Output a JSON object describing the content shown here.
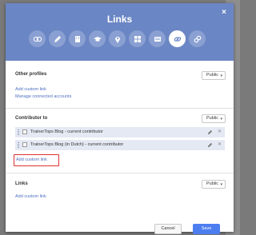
{
  "dialog": {
    "title": "Links",
    "close_symbol": "×"
  },
  "categories": [
    {
      "icon": "circles-icon",
      "active": false
    },
    {
      "icon": "pencil-icon",
      "active": false
    },
    {
      "icon": "building-icon",
      "active": false
    },
    {
      "icon": "graduation-cap-icon",
      "active": false
    },
    {
      "icon": "map-pin-icon",
      "active": false
    },
    {
      "icon": "grid-icon",
      "active": false
    },
    {
      "icon": "card-icon",
      "active": false
    },
    {
      "icon": "link-icon",
      "active": true
    },
    {
      "icon": "chain-icon",
      "active": false
    }
  ],
  "other_profiles": {
    "label": "Other profiles",
    "visibility": "Public",
    "add_link": "Add custom link",
    "manage_link": "Manage connected accounts"
  },
  "contributor": {
    "label": "Contributor to",
    "visibility": "Public",
    "rows": [
      {
        "text": "TrainerTops Blog - current contributor"
      },
      {
        "text": "TrainerTops Blog (in Dutch) - current contributor"
      }
    ],
    "add_link": "Add custom link"
  },
  "links": {
    "label": "Links",
    "visibility": "Public",
    "add_link": "Add custom link"
  },
  "footer": {
    "cancel": "Cancel",
    "save": "Save"
  },
  "colors": {
    "header": "#6b86c4",
    "accent": "#4d7ef0",
    "highlight": "#e03030"
  }
}
